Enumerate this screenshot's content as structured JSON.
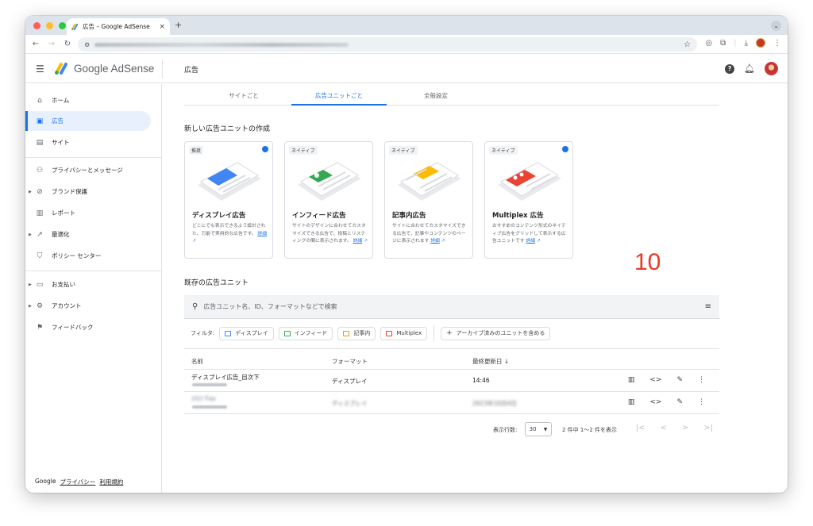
{
  "browser": {
    "tab_title": "広告 – Google AdSense",
    "tab_close": "×",
    "new_tab": "+",
    "traffic_lights": [
      "#fe5f57",
      "#febc2e",
      "#28c840"
    ]
  },
  "header": {
    "brand": "Google AdSense",
    "title": "広告"
  },
  "sidebar": {
    "items": [
      {
        "label": "ホーム",
        "icon": "home-icon"
      },
      {
        "label": "広告",
        "icon": "ads-icon"
      },
      {
        "label": "サイト",
        "icon": "sites-icon"
      },
      {
        "label": "プライバシーとメッセージ",
        "icon": "privacy-icon"
      },
      {
        "label": "ブランド保護",
        "icon": "block-icon"
      },
      {
        "label": "レポート",
        "icon": "report-icon"
      },
      {
        "label": "最適化",
        "icon": "trend-icon"
      },
      {
        "label": "ポリシー センター",
        "icon": "shield-icon"
      },
      {
        "label": "お支払い",
        "icon": "payment-icon"
      },
      {
        "label": "アカウント",
        "icon": "gear-icon"
      },
      {
        "label": "フィードバック",
        "icon": "feedback-icon"
      }
    ],
    "footer": {
      "google": "Google",
      "privacy": "プライバシー",
      "terms": "利用規約"
    }
  },
  "subtabs": {
    "by_site": "サイトごと",
    "by_unit": "広告ユニットごと",
    "global": "全般設定"
  },
  "create_section": {
    "title": "新しい広告ユニットの作成",
    "cards": [
      {
        "badge": "推奨",
        "title": "ディスプレイ広告",
        "desc": "どこにでも表示できるよう設計された、万能で実用的な広告です。",
        "link": "詳細",
        "accent": "#4285f4",
        "info": true
      },
      {
        "badge": "ネイティブ",
        "title": "インフィード広告",
        "desc": "サイトのデザインに合わせてカスタマイズできる広告で、投稿とリスティングの間に表示されます。",
        "link": "詳細",
        "accent": "#34a853",
        "info": false
      },
      {
        "badge": "ネイティブ",
        "title": "記事内広告",
        "desc": "サイトに合わせてカスタマイズできる広告で、記事やコンテンツのページに表示されます",
        "link": "詳細",
        "accent": "#fbbc04",
        "info": false
      },
      {
        "badge": "ネイティブ",
        "title": "Multiplex 広告",
        "desc": "おすすめのコンテンツ形式のネイティブ広告をグリッドして表示する広告ユニットです",
        "link": "詳細",
        "accent": "#ea4335",
        "info": true
      }
    ]
  },
  "annotation": "10",
  "existing": {
    "title": "既存の広告ユニット",
    "search_placeholder": "広告ユニット名、ID、フォーマットなどで検索",
    "filter_label": "フィルタ:",
    "chips": [
      {
        "label": "ディスプレイ",
        "color": "#4285f4"
      },
      {
        "label": "インフィード",
        "color": "#34a853"
      },
      {
        "label": "記事内",
        "color": "#fb8c00"
      },
      {
        "label": "Multiplex",
        "color": "#ea4335"
      }
    ],
    "archive_chip": "アーカイブ済みのユニットを含める",
    "columns": {
      "name": "名前",
      "format": "フォーマット",
      "updated": "最終更新日 ↓"
    },
    "rows": [
      {
        "name": "ディスプレイ広告_目次下",
        "format": "ディスプレイ",
        "updated": "14:46"
      },
      {
        "name": "ｽｸｴｱ Fxx",
        "format": "ディスプレイ",
        "updated": "2023年10月4日"
      }
    ],
    "pager": {
      "rows_label": "表示行数:",
      "rows_value": "30",
      "range": "2 件中 1〜2 件を表示"
    }
  }
}
